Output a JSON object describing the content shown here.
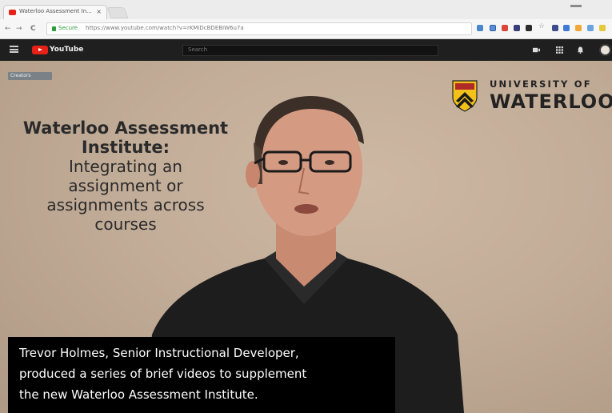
{
  "browser": {
    "tab_title": "Waterloo Assessment In...",
    "tab_close": "×",
    "back": "←",
    "forward": "→",
    "reload": "C",
    "secure_label": "Secure",
    "url": "https://www.youtube.com/watch?v=rKMiDcBDEBIW6u7a",
    "colors": {
      "tabbar": "#ececec",
      "addrbar": "#f6f6f6",
      "secure": "#2e9b3e"
    }
  },
  "youtube": {
    "logo_text": "YouTube",
    "search_placeholder": "Search",
    "colors": {
      "topbar": "#1f1f1f",
      "brand": "#e62117"
    }
  },
  "video": {
    "channel_badge": "Creators",
    "logo_university": "UNIVERSITY OF",
    "logo_waterloo": "WATERLOO",
    "slide_title_line1": "Waterloo Assessment",
    "slide_title_line2": "Institute:",
    "slide_subtitle_line1": "Integrating an",
    "slide_subtitle_line2": "assignment or",
    "slide_subtitle_line3": "assignments across",
    "slide_subtitle_line4": "courses"
  },
  "caption": {
    "line1": "Trevor Holmes, Senior Instructional Developer,",
    "line2": "produced a series of brief videos to supplement",
    "line3": "the new Waterloo Assessment Institute."
  }
}
